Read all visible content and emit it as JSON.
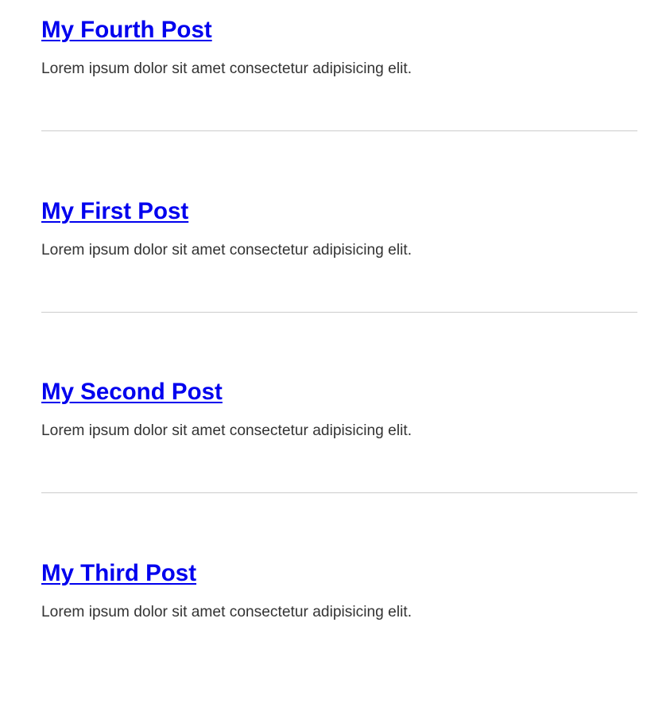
{
  "posts": [
    {
      "title": "My Fourth Post",
      "excerpt": "Lorem ipsum dolor sit amet consectetur adipisicing elit."
    },
    {
      "title": "My First Post",
      "excerpt": "Lorem ipsum dolor sit amet consectetur adipisicing elit."
    },
    {
      "title": "My Second Post",
      "excerpt": "Lorem ipsum dolor sit amet consectetur adipisicing elit."
    },
    {
      "title": "My Third Post",
      "excerpt": "Lorem ipsum dolor sit amet consectetur adipisicing elit."
    }
  ],
  "colors": {
    "link": "#0000ee",
    "text": "#333333",
    "divider": "#cccccc",
    "background": "#ffffff"
  }
}
